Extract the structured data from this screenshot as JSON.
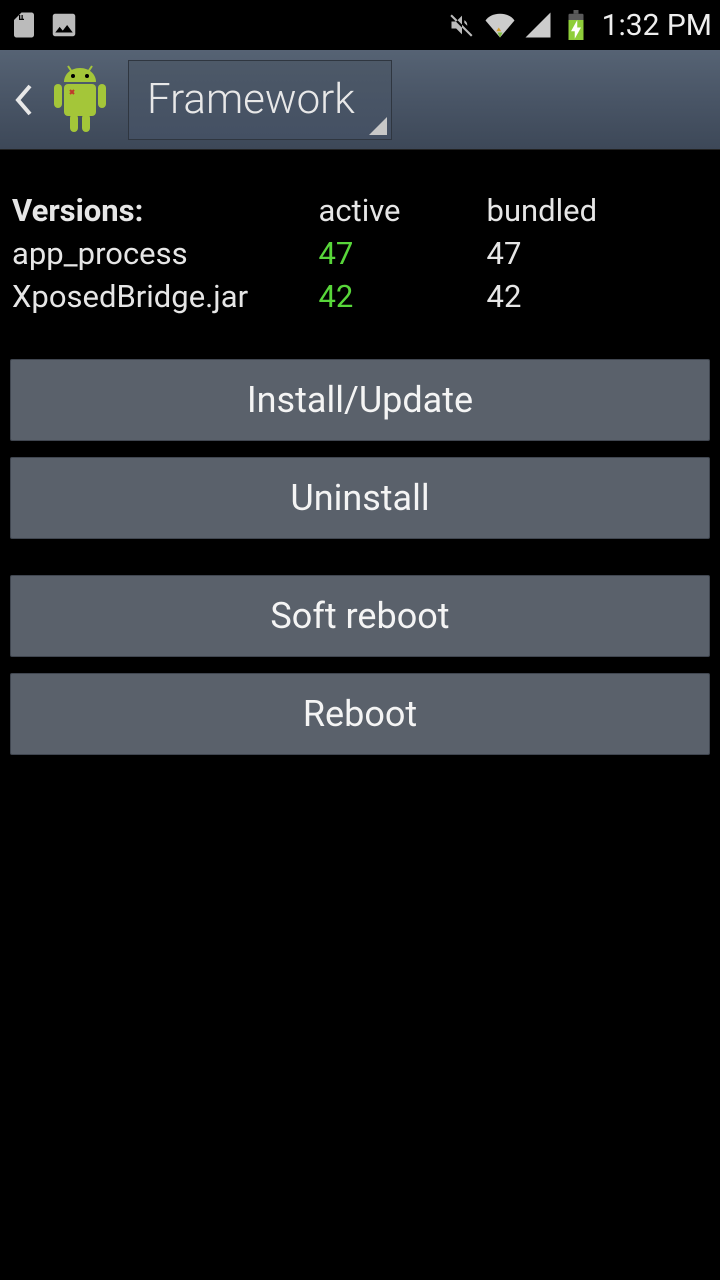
{
  "status": {
    "time": "1:32 PM"
  },
  "actionbar": {
    "spinner_label": "Framework"
  },
  "versions": {
    "heading": "Versions:",
    "col_active": "active",
    "col_bundled": "bundled",
    "rows": [
      {
        "label": "app_process",
        "active": "47",
        "bundled": "47"
      },
      {
        "label": "XposedBridge.jar",
        "active": "42",
        "bundled": "42"
      }
    ]
  },
  "buttons": {
    "install": "Install/Update",
    "uninstall": "Uninstall",
    "soft_reboot": "Soft reboot",
    "reboot": "Reboot"
  }
}
